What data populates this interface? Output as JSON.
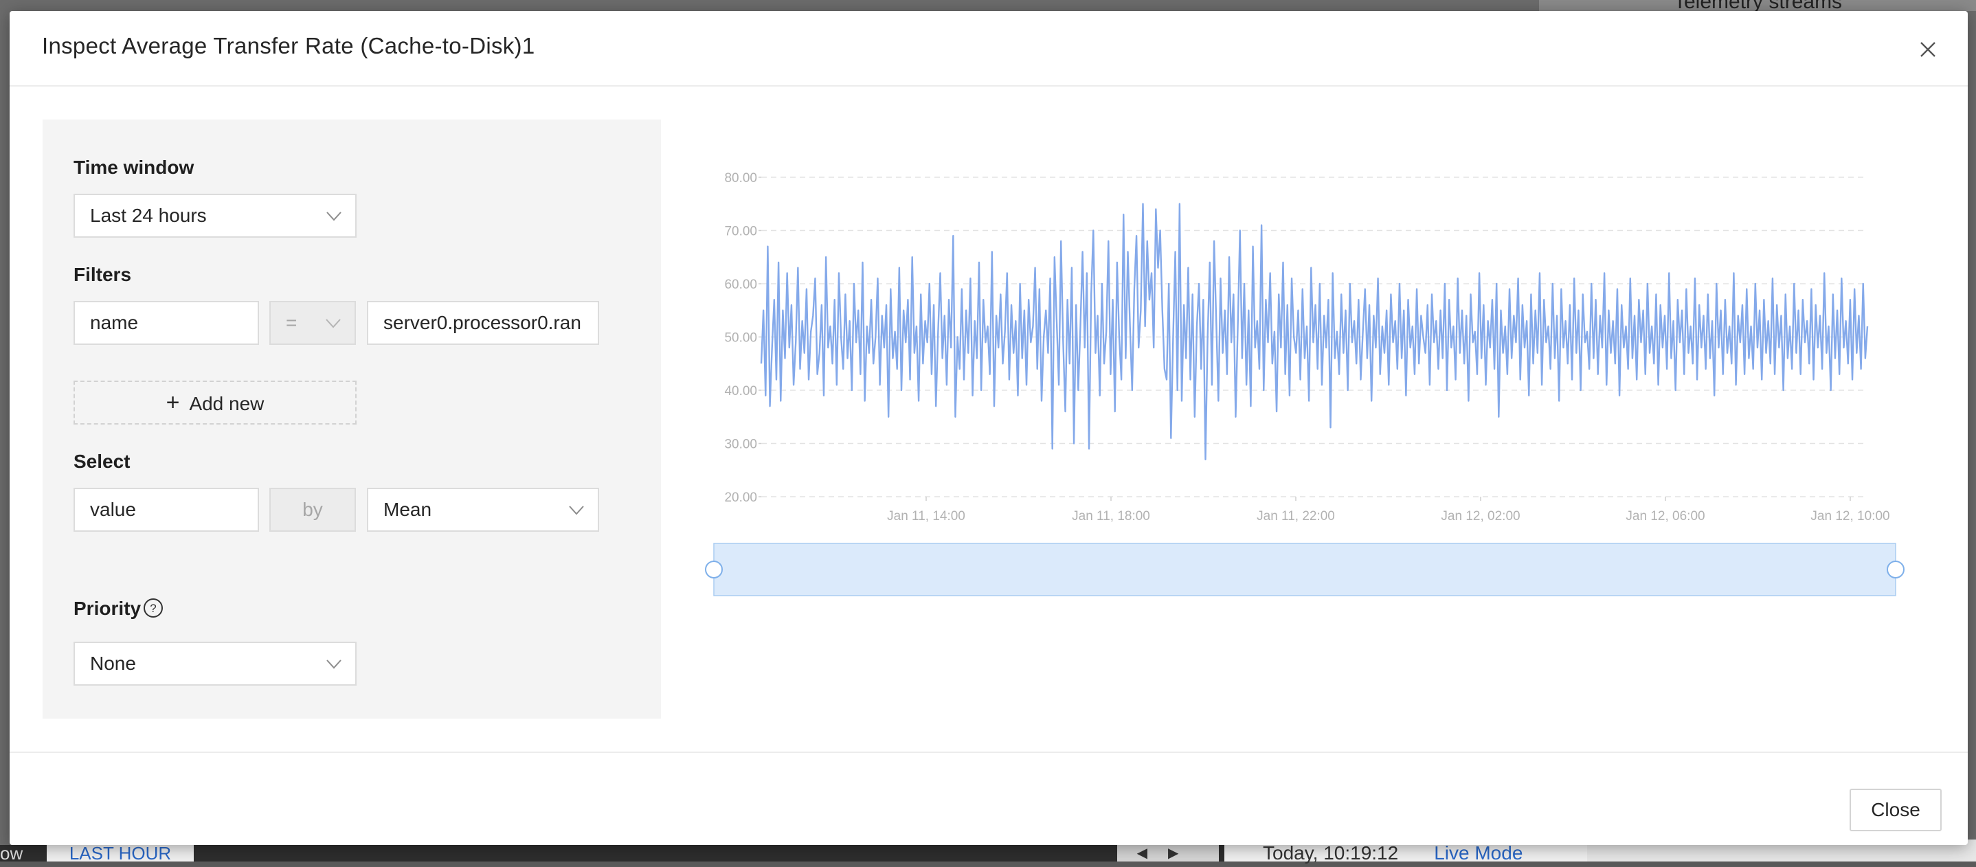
{
  "background": {
    "telemetry_title": "Telemetry streams",
    "left_fragment": "ow",
    "last_hour_label": "LAST HOUR",
    "time_display": "Today, 10:19:12",
    "live_mode_label": "Live Mode"
  },
  "modal": {
    "title": "Inspect Average Transfer Rate (Cache-to-Disk)1",
    "close_label": "Close"
  },
  "form": {
    "time_window": {
      "label": "Time window",
      "value": "Last 24 hours"
    },
    "filters": {
      "label": "Filters",
      "field": "name",
      "operator": "=",
      "value": "server0.processor0.ran"
    },
    "add_new_label": "Add new",
    "select": {
      "label": "Select",
      "field": "value",
      "by_label": "by",
      "aggregation": "Mean"
    },
    "priority": {
      "label": "Priority",
      "value": "None"
    }
  },
  "colors": {
    "line": "#84a9ea",
    "range": "#dbeafb",
    "range_border": "#a9ccf2"
  },
  "chart_data": {
    "type": "line",
    "yticks": [
      "80.00",
      "70.00",
      "60.00",
      "50.00",
      "40.00",
      "30.00",
      "20.00"
    ],
    "ylim": [
      20,
      80
    ],
    "xticks": [
      "Jan 11, 14:00",
      "Jan 11, 18:00",
      "Jan 11, 22:00",
      "Jan 12, 02:00",
      "Jan 12, 06:00",
      "Jan 12, 10:00"
    ],
    "x_start": "Jan 11, 10:20",
    "x_end": "Jan 12, 10:20",
    "grid": true,
    "series": [
      {
        "values": [
          45,
          55,
          39,
          67,
          37,
          48,
          57,
          42,
          64,
          38,
          55,
          46,
          62,
          48,
          56,
          41,
          49,
          63,
          44,
          53,
          47,
          59,
          42,
          51,
          54,
          61,
          43,
          47,
          56,
          39,
          65,
          48,
          52,
          45,
          57,
          41,
          62,
          50,
          44,
          58,
          46,
          53,
          40,
          60,
          49,
          55,
          43,
          64,
          38,
          52,
          47,
          57,
          45,
          50,
          61,
          41,
          54,
          48,
          56,
          35,
          59,
          46,
          51,
          44,
          63,
          40,
          55,
          49,
          57,
          42,
          65,
          47,
          52,
          38,
          58,
          45,
          53,
          49,
          60,
          43,
          56,
          37,
          51,
          62,
          46,
          54,
          41,
          57,
          48,
          69,
          35,
          50,
          44,
          59,
          42,
          55,
          47,
          61,
          39,
          53,
          46,
          64,
          40,
          57,
          49,
          52,
          43,
          66,
          37,
          54,
          48,
          58,
          45,
          51,
          62,
          42,
          56,
          47,
          53,
          39,
          60,
          46,
          55,
          41,
          57,
          49,
          52,
          63,
          44,
          59,
          38,
          50,
          55,
          47,
          61,
          29,
          65,
          53,
          41,
          68,
          49,
          36,
          57,
          45,
          63,
          30,
          56,
          40,
          52,
          66,
          48,
          62,
          29,
          58,
          70,
          47,
          54,
          39,
          60,
          45,
          51,
          68,
          43,
          57,
          36,
          64,
          50,
          42,
          73,
          46,
          66,
          52,
          40,
          59,
          69,
          48,
          55,
          75,
          52,
          68,
          57,
          62,
          48,
          74,
          63,
          70,
          55,
          44,
          42,
          60,
          31,
          50,
          66,
          40,
          75,
          38,
          56,
          46,
          63,
          42,
          58,
          35,
          52,
          60,
          44,
          57,
          27,
          50,
          64,
          41,
          68,
          53,
          38,
          61,
          47,
          55,
          43,
          65,
          49,
          58,
          35,
          52,
          70,
          46,
          60,
          41,
          55,
          37,
          67,
          48,
          53,
          44,
          71,
          40,
          57,
          49,
          62,
          45,
          51,
          36,
          58,
          48,
          64,
          43,
          56,
          39,
          61,
          50,
          47,
          55,
          42,
          59,
          46,
          52,
          38,
          63,
          49,
          56,
          44,
          60,
          41,
          54,
          48,
          57,
          33,
          62,
          46,
          51,
          43,
          58,
          47,
          55,
          40,
          60,
          49,
          53,
          45,
          57,
          42,
          51,
          59,
          46,
          56,
          38,
          54,
          48,
          61,
          43,
          52,
          47,
          55,
          41,
          58,
          49,
          53,
          44,
          60,
          46,
          55,
          39,
          57,
          48,
          52,
          43,
          59,
          45,
          54,
          50,
          47,
          56,
          41,
          58,
          49,
          53,
          44,
          55,
          46,
          60,
          40,
          57,
          48,
          52,
          42,
          61,
          47,
          55,
          45,
          54,
          38,
          58,
          49,
          51,
          43,
          62,
          46,
          56,
          41,
          53,
          48,
          57,
          44,
          60,
          35,
          55,
          47,
          52,
          43,
          59,
          46,
          54,
          49,
          61,
          42,
          56,
          48,
          53,
          39,
          58,
          45,
          55,
          47,
          62,
          41,
          57,
          49,
          52,
          44,
          60,
          46,
          54,
          38,
          59,
          48,
          53,
          45,
          56,
          42,
          61,
          47,
          55,
          40,
          58,
          49,
          51,
          44,
          60,
          46,
          57,
          43,
          54,
          48,
          62,
          41,
          55,
          47,
          53,
          45,
          59,
          39,
          56,
          48,
          52,
          44,
          61,
          46,
          54,
          42,
          57,
          49,
          55,
          43,
          60,
          47,
          52,
          45,
          58,
          41,
          56,
          48,
          54,
          44,
          62,
          46,
          53,
          40,
          57,
          49,
          55,
          43,
          59,
          47,
          52,
          45,
          61,
          42,
          56,
          48,
          54,
          44,
          58,
          46,
          53,
          39,
          60,
          48,
          55,
          43,
          57,
          47,
          52,
          45,
          62,
          41,
          54,
          49,
          56,
          43,
          59,
          46,
          52,
          44,
          60,
          48,
          55,
          42,
          57,
          47,
          53,
          45,
          61,
          43,
          56,
          48,
          54,
          40,
          58,
          46,
          52,
          44,
          60,
          47,
          55,
          43,
          57,
          49,
          53,
          45,
          59,
          42,
          56,
          48,
          54,
          44,
          62,
          47,
          52,
          40,
          58,
          46,
          55,
          43,
          61,
          48,
          53,
          45,
          57,
          42,
          59,
          47,
          54,
          44,
          60,
          46,
          52
        ]
      }
    ]
  }
}
